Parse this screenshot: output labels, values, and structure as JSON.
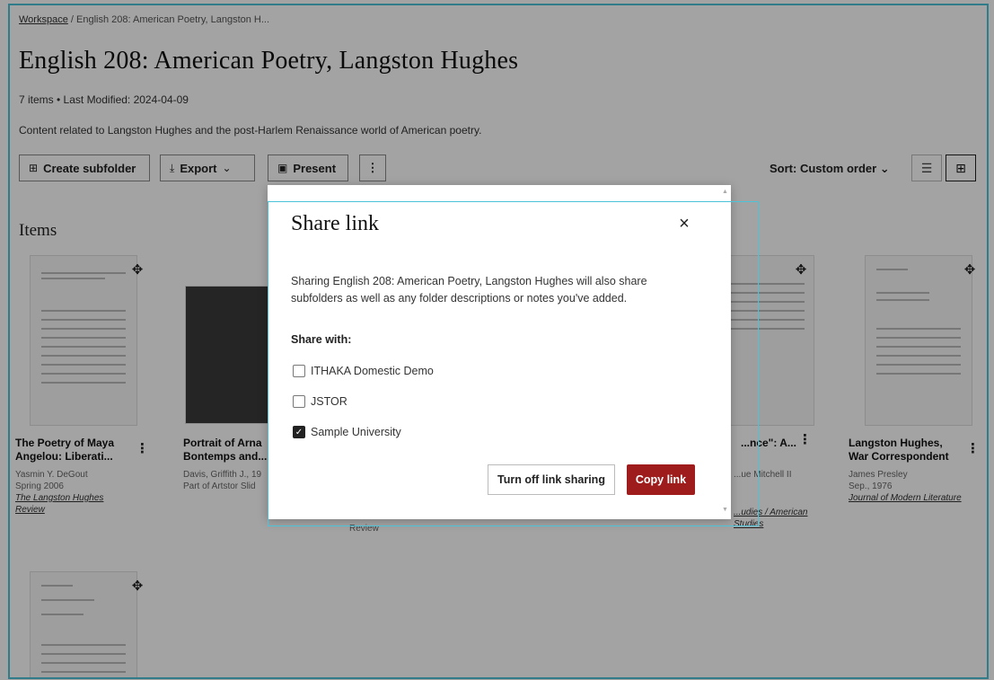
{
  "breadcrumb": {
    "root": "Workspace",
    "separator": "/",
    "current": "English 208: American Poetry, Langston H..."
  },
  "page": {
    "title": "English 208: American Poetry, Langston Hughes",
    "meta": "7 items • Last Modified: 2024-04-09",
    "description": "Content related to Langston Hughes and the post-Harlem Renaissance world of American poetry."
  },
  "toolbar": {
    "create_subfolder": "Create subfolder",
    "export": "Export",
    "present": "Present",
    "more": "⋮",
    "sort": "Sort: Custom order"
  },
  "items_heading": "Items",
  "cards": [
    {
      "title": "The Poetry of Maya Angelou: Liberati...",
      "meta1": "Yasmin Y. DeGout",
      "meta2": "Spring 2006",
      "link": "The Langston Hughes Review"
    },
    {
      "title": "Portrait of Arna Bontemps and...",
      "meta1": "Davis, Griffith J., 19",
      "meta2": "Part of Artstor Slid",
      "link": ""
    },
    {
      "title": "...nce\": A...",
      "meta1": "...ue Mitchell II",
      "meta2": "",
      "link": "...udies / American Studies"
    },
    {
      "title": "Langston Hughes, War Correspondent",
      "meta1": "James Presley",
      "meta2": "Sep., 1976",
      "link": "Journal of Modern Literature"
    }
  ],
  "hidden_fragment": "Review",
  "modal": {
    "title": "Share link",
    "close": "×",
    "description": "Sharing English 208: American Poetry, Langston Hughes will also share subfolders as well as any folder descriptions or notes you've added.",
    "share_with_label": "Share with:",
    "options": [
      {
        "label": "ITHAKA Domestic Demo",
        "checked": false
      },
      {
        "label": "JSTOR",
        "checked": false
      },
      {
        "label": "Sample University",
        "checked": true
      }
    ],
    "turn_off": "Turn off link sharing",
    "copy": "Copy link"
  },
  "colors": {
    "accent": "#9e1c1c",
    "highlight_outline": "#4cc3d9"
  }
}
